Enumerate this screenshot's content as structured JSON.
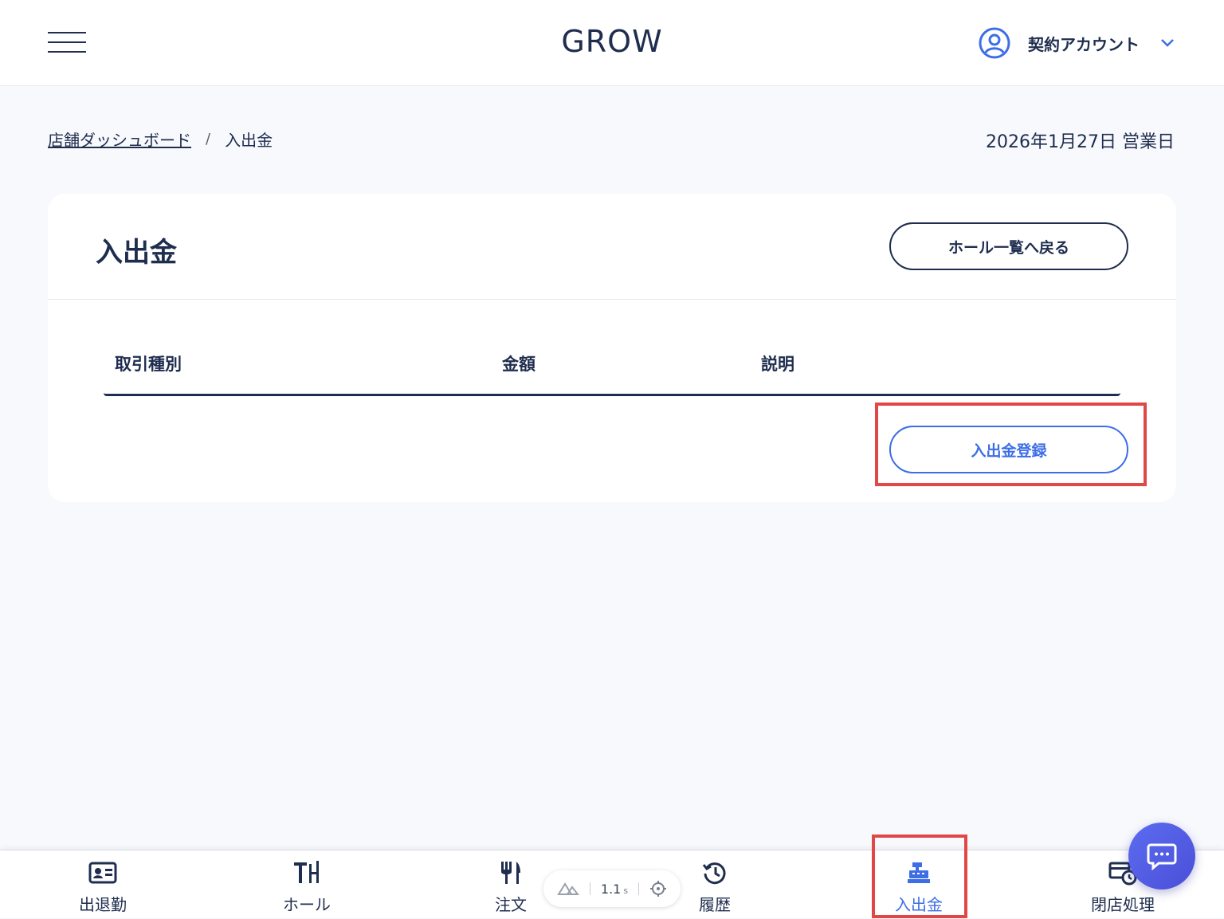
{
  "header": {
    "logo": "GROW",
    "account_name": "契約アカウント"
  },
  "breadcrumb": {
    "home": "店舗ダッシュボード",
    "separator": "/",
    "current": "入出金"
  },
  "business_date": "2026年1月27日 営業日",
  "card": {
    "title": "入出金",
    "back_button": "ホール一覧へ戻る",
    "columns": [
      "取引種別",
      "金額",
      "説明"
    ],
    "register_button": "入出金登録"
  },
  "bottom_nav": {
    "items": [
      {
        "label": "出退勤",
        "icon": "id-card-icon"
      },
      {
        "label": "ホール",
        "icon": "table-icon"
      },
      {
        "label": "注文",
        "icon": "utensils-icon"
      },
      {
        "label": "履歴",
        "icon": "history-icon"
      },
      {
        "label": "入出金",
        "icon": "cash-register-icon",
        "active": true
      },
      {
        "label": "閉店処理",
        "icon": "store-close-icon"
      }
    ]
  },
  "devtools": {
    "time_value": "1.1",
    "time_unit": "s"
  },
  "colors": {
    "primary": "#1f2d4e",
    "accent": "#3d6ee6",
    "highlight": "#e04848",
    "background": "#f8f9fd"
  }
}
